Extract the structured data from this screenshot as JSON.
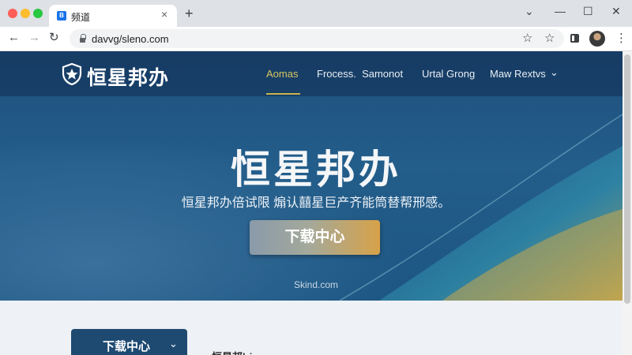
{
  "browser": {
    "tab": {
      "title": "频道",
      "favicon": "B",
      "close": "×"
    },
    "new_tab": "+",
    "window_controls": {
      "minimize": "⌄",
      "min": "—",
      "max": "☐",
      "close": "✕"
    },
    "nav": {
      "back": "←",
      "forward": "→",
      "reload": "↻"
    },
    "url": "davvg/sleno.com",
    "icons": {
      "bookmark_star": "☆",
      "extension_star": "☆",
      "menu": "⋮"
    }
  },
  "site": {
    "brand": "恒星邦办",
    "nav": [
      {
        "label": "Aomas",
        "active": true
      },
      {
        "label": "Frocess.  Samonot",
        "active": false
      },
      {
        "label": "Urtal Grong",
        "active": false
      },
      {
        "label": "Maw Rextvs",
        "active": false,
        "chevron": "⌄"
      }
    ],
    "hero": {
      "title": "恒星邦办",
      "subtitle": "恒星邦办倍试限 煽认囍星巨产齐能筒替帮邢感。",
      "cta": "下载中心",
      "domain": "Skind.com"
    },
    "section": {
      "download_button": "下载中心",
      "download_chevron": "⌄",
      "text": "恒星邦|riwom"
    }
  },
  "colors": {
    "accent_gold": "#d7c561",
    "hero_blue": "#235d8a",
    "cta_orange": "#d7a248",
    "dark_button": "#1e4a72"
  }
}
